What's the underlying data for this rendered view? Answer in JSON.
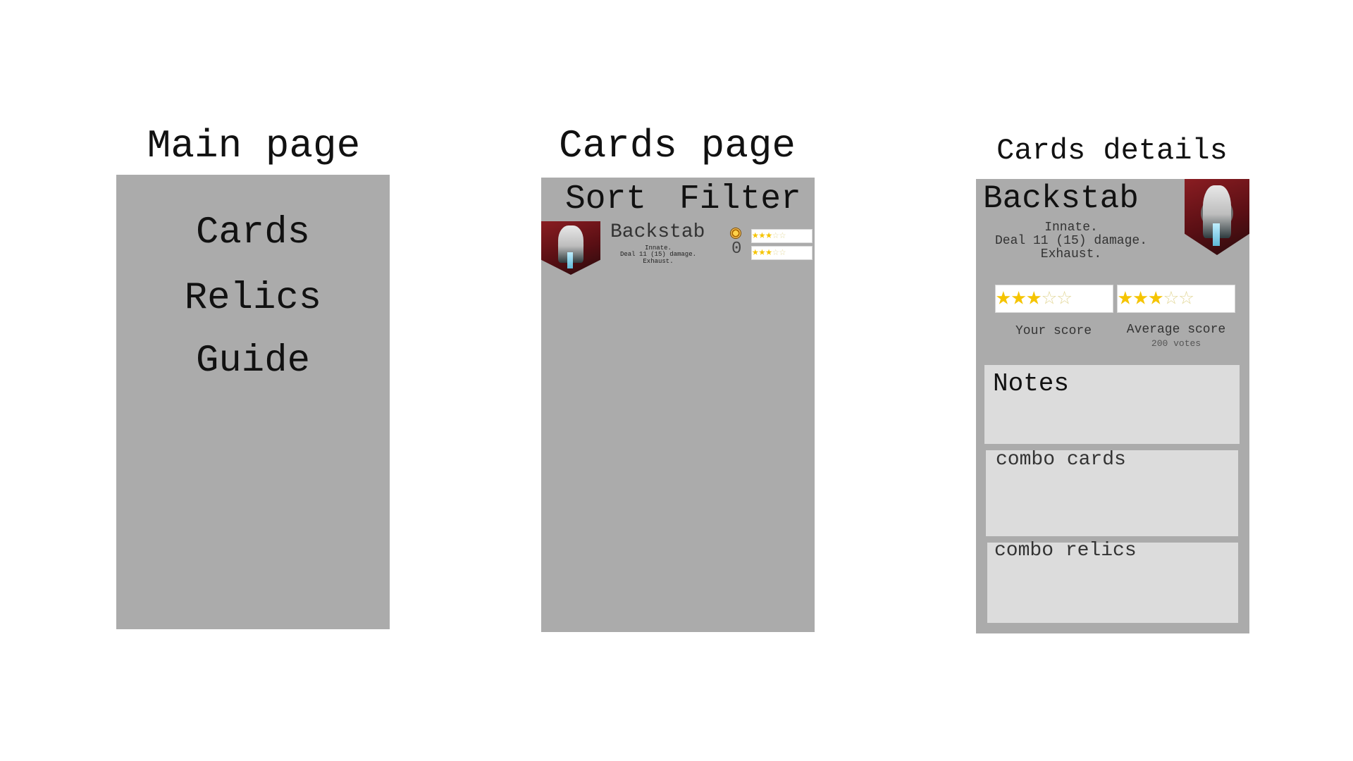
{
  "main_page": {
    "title": "Main page",
    "menu": [
      {
        "label": "Cards"
      },
      {
        "label": "Relics"
      },
      {
        "label": "Guide"
      }
    ]
  },
  "cards_page": {
    "title": "Cards page",
    "toolbar": {
      "sort_label": "Sort",
      "filter_label": "Filter"
    },
    "card": {
      "name": "Backstab",
      "desc_line1": "Innate.",
      "desc_line2": "Deal 11 (15) damage.",
      "desc_line3": "Exhaust.",
      "count": "0",
      "your_score_stars": 3,
      "avg_score_stars": 3,
      "max_stars": 5
    }
  },
  "card_details": {
    "title": "Cards details",
    "name": "Backstab",
    "desc_line1": "Innate.",
    "desc_line2": "Deal 11 (15) damage.",
    "desc_line3": "Exhaust.",
    "your_score_stars": 3,
    "avg_score_stars": 3,
    "max_stars": 5,
    "your_score_label": "Your score",
    "avg_score_label": "Average score",
    "votes_label": "200 votes",
    "notes_label": "Notes",
    "combo_cards_label": "combo cards",
    "combo_relics_label": "combo relics"
  },
  "colors": {
    "panel_bg": "#ababab",
    "box_bg": "#dcdcdc",
    "star": "#f5c400",
    "thumb_bg": "#8a1d22"
  }
}
